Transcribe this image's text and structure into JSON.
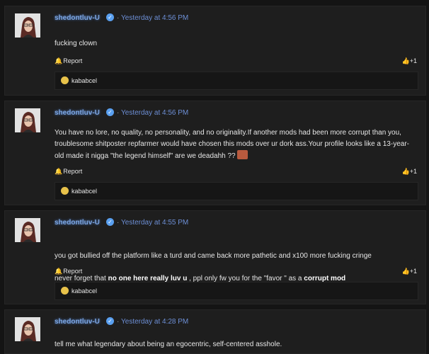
{
  "posts": [
    {
      "username": "shedontluv-U",
      "separator": "·",
      "time": "Yesterday at 4:56 PM",
      "message": "fucking clown",
      "report_label": "Report",
      "like_count": "+1",
      "reaction_user": "kababcel"
    },
    {
      "username": "shedontluv-U",
      "separator": "·",
      "time": "Yesterday at 4:56 PM",
      "message": "You have no lore, no quality, no personality, and no originality.If another mods had been more corrupt than you, troublesome shitposter repfarmer would have chosen this mods over ur dork ass.Your profile looks like a 13-year-old made it nigga \"the legend himself\" are we deadahh ??",
      "report_label": "Report",
      "like_count": "+1",
      "reaction_user": "kababcel"
    },
    {
      "username": "shedontluv-U",
      "separator": "·",
      "time": "Yesterday at 4:55 PM",
      "message_line1": "you got bullied off the platform like a turd and came back more pathetic and x100 more fucking cringe",
      "message_line2_a": "never forget that ",
      "message_line2_b": "no one here really luv u",
      "message_line2_c": " , ppl only fw you for the \"favor \" as a ",
      "message_line2_d": "corrupt mod",
      "report_label": "Report",
      "like_count": "+1",
      "reaction_user": "kababcel"
    },
    {
      "username": "shedontluv-U",
      "separator": "·",
      "time": "Yesterday at 4:28 PM",
      "message": "tell me what legendary about being an egocentric, self-centered asshole."
    }
  ]
}
